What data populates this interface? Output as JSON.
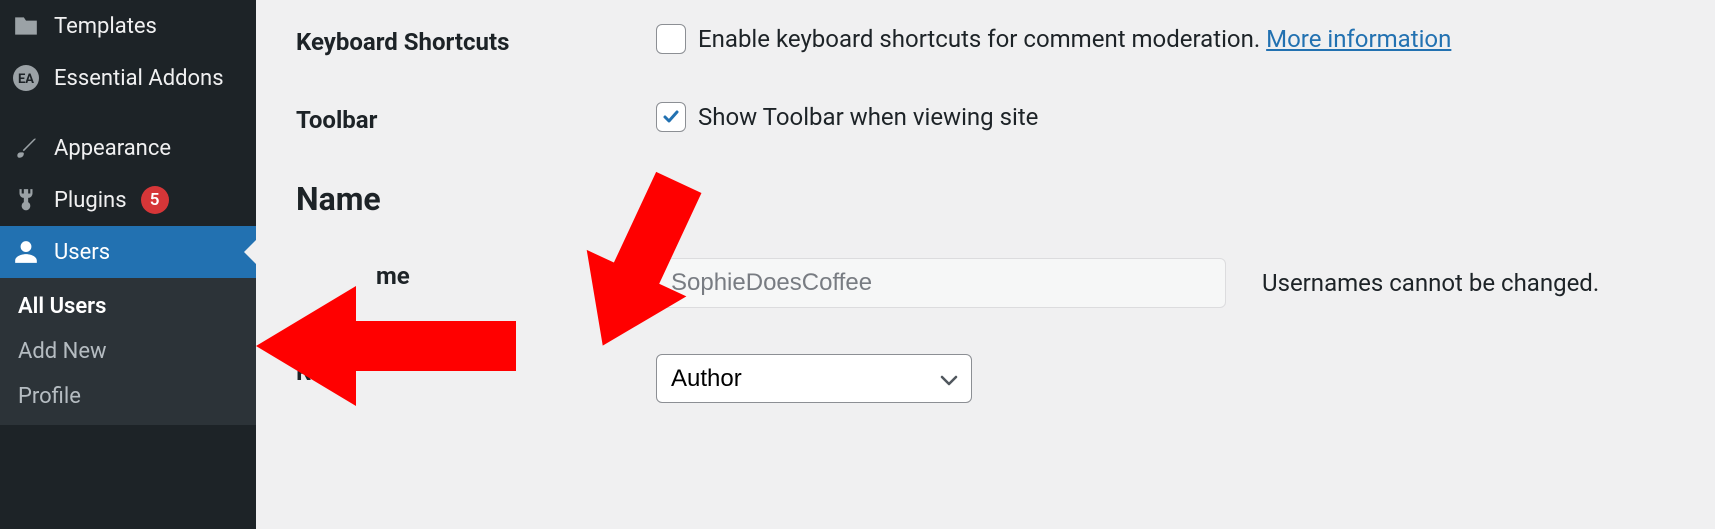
{
  "sidebar": {
    "items": [
      {
        "label": "Templates",
        "icon": "folder"
      },
      {
        "label": "Essential Addons",
        "icon": "ea"
      },
      {
        "label": "Appearance",
        "icon": "brush"
      },
      {
        "label": "Plugins",
        "icon": "plug",
        "badge": "5"
      },
      {
        "label": "Users",
        "icon": "user"
      }
    ],
    "submenu": [
      {
        "label": "All Users",
        "active": true
      },
      {
        "label": "Add New"
      },
      {
        "label": "Profile"
      }
    ]
  },
  "form": {
    "keyboard_label": "Keyboard Shortcuts",
    "keyboard_checkbox_text": "Enable keyboard shortcuts for comment moderation. ",
    "keyboard_link": "More information",
    "toolbar_label": "Toolbar",
    "toolbar_checkbox_text": "Show Toolbar when viewing site",
    "name_heading": "Name",
    "username_label": "me",
    "username_value": "SophieDoesCoffee",
    "username_help": "Usernames cannot be changed.",
    "role_label": "Role",
    "role_value": "Author"
  }
}
